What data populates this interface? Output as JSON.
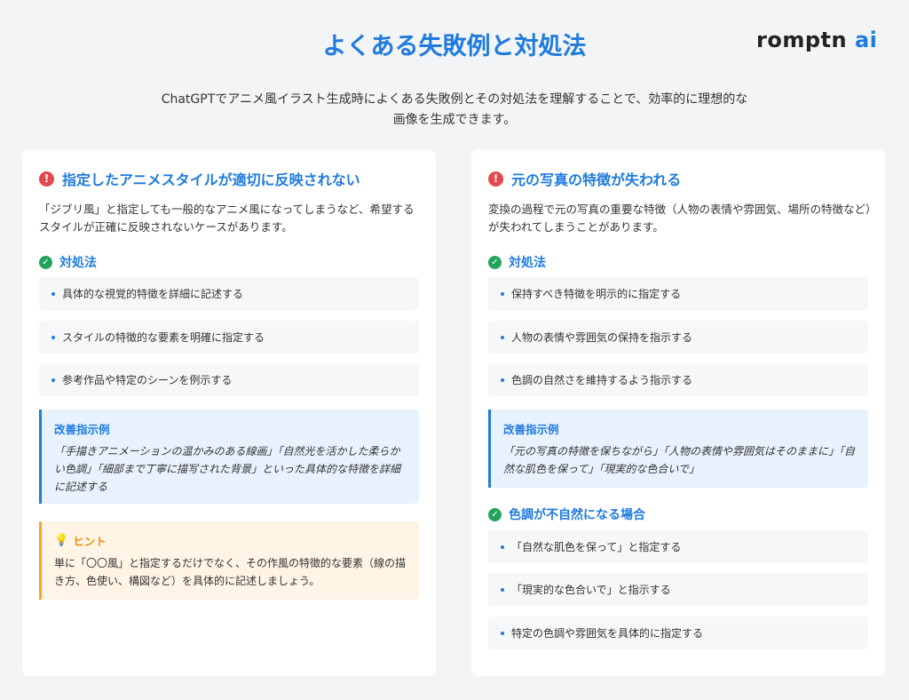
{
  "header": {
    "title": "よくある失敗例と対処法",
    "logo_main": "romptn",
    "logo_accent": "ai",
    "subtitle": "ChatGPTでアニメ風イラスト生成時によくある失敗例とその対処法を理解することで、効率的に理想的な画像を生成できます。"
  },
  "colors": {
    "accent": "#1f7be0",
    "alert": "#e5484d",
    "check": "#22a35a",
    "hint": "#f5a623"
  },
  "icons": {
    "alert": "exclamation-circle-icon",
    "check": "check-circle-icon",
    "hint": "lightbulb-icon"
  },
  "left": {
    "title": "指定したアニメスタイルが適切に反映されない",
    "description": "「ジブリ風」と指定しても一般的なアニメ風になってしまうなど、希望するスタイルが正確に反映されないケースがあります。",
    "solution_title": "対処法",
    "items": [
      "具体的な視覚的特徴を詳細に記述する",
      "スタイルの特徴的な要素を明確に指定する",
      "参考作品や特定のシーンを例示する"
    ],
    "example_title": "改善指示例",
    "example_text": "「手描きアニメーションの温かみのある線画」「自然光を活かした柔らかい色調」「細部まで丁寧に描写された背景」といった具体的な特徴を詳細に記述する",
    "hint_title": "ヒント",
    "hint_text": "単に「〇〇風」と指定するだけでなく、その作風の特徴的な要素（線の描き方、色使い、構図など）を具体的に記述しましょう。"
  },
  "right": {
    "title": "元の写真の特徴が失われる",
    "description": "変換の過程で元の写真の重要な特徴（人物の表情や雰囲気、場所の特徴など）が失われてしまうことがあります。",
    "solution_title": "対処法",
    "items": [
      "保持すべき特徴を明示的に指定する",
      "人物の表情や雰囲気の保持を指示する",
      "色調の自然さを維持するよう指示する"
    ],
    "example_title": "改善指示例",
    "example_text": "「元の写真の特徴を保ちながら」「人物の表情や雰囲気はそのままに」「自然な肌色を保って」「現実的な色合いで」",
    "section2_title": "色調が不自然になる場合",
    "items2": [
      "「自然な肌色を保って」と指定する",
      "「現実的な色合いで」と指示する",
      "特定の色調や雰囲気を具体的に指定する"
    ]
  }
}
